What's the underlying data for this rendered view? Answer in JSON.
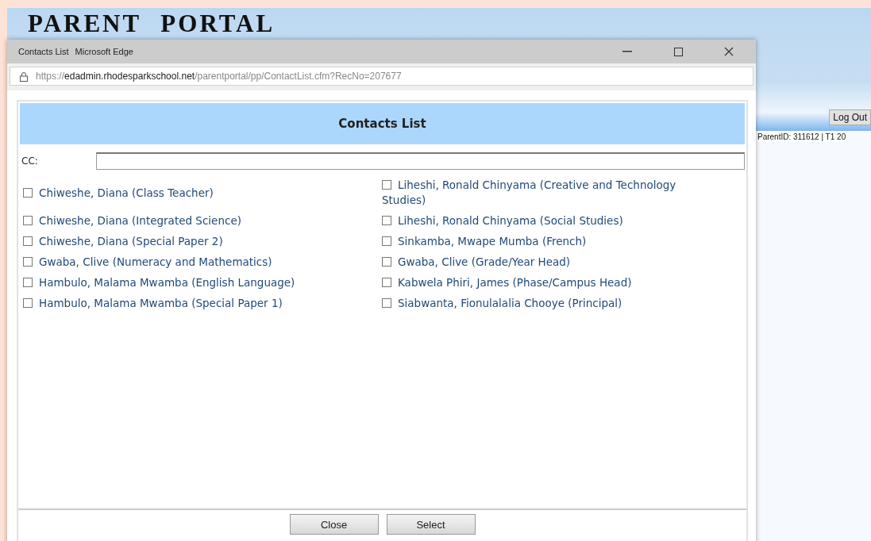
{
  "page": {
    "title": "PARENT PORTAL",
    "logout_button": "Log Out",
    "status": "ParentID: 311612 | T1 20"
  },
  "popup": {
    "title": "Contacts List",
    "app": "Microsoft Edge",
    "url": {
      "scheme": "https://",
      "host": "edadmin.rhodesparkschool.net",
      "path": "/parentportal/pp/ContactList.cfm?RecNo=207677"
    },
    "heading": "Contacts List",
    "cc": {
      "label": "CC:"
    },
    "columns": [
      [
        {
          "name": "Chiweshe, Diana (Class Teacher)",
          "checked": false
        },
        {
          "name": "Chiweshe, Diana (Integrated Science)",
          "checked": false
        },
        {
          "name": "Chiweshe, Diana (Special Paper 2)",
          "checked": false
        },
        {
          "name": "Gwaba, Clive (Numeracy and Mathematics)",
          "checked": false
        },
        {
          "name": "Hambulo, Malama Mwamba (English Language)",
          "checked": false
        },
        {
          "name": "Hambulo, Malama Mwamba (Special Paper 1)",
          "checked": false
        }
      ],
      [
        {
          "name": "Liheshi, Ronald Chinyama (Creative and Technology Studies)",
          "checked": false
        },
        {
          "name": "Liheshi, Ronald Chinyama (Social Studies)",
          "checked": false
        },
        {
          "name": "Sinkamba, Mwape Mumba (French)",
          "checked": false
        },
        {
          "name": "Gwaba, Clive (Grade/Year Head)",
          "checked": false
        },
        {
          "name": "Kabwela Phiri, James (Phase/Campus Head)",
          "checked": false
        },
        {
          "name": "Siabwanta, Fionulalalia Chooye (Principal)",
          "checked": false
        }
      ]
    ],
    "buttons": [
      "Close",
      "Select"
    ]
  }
}
